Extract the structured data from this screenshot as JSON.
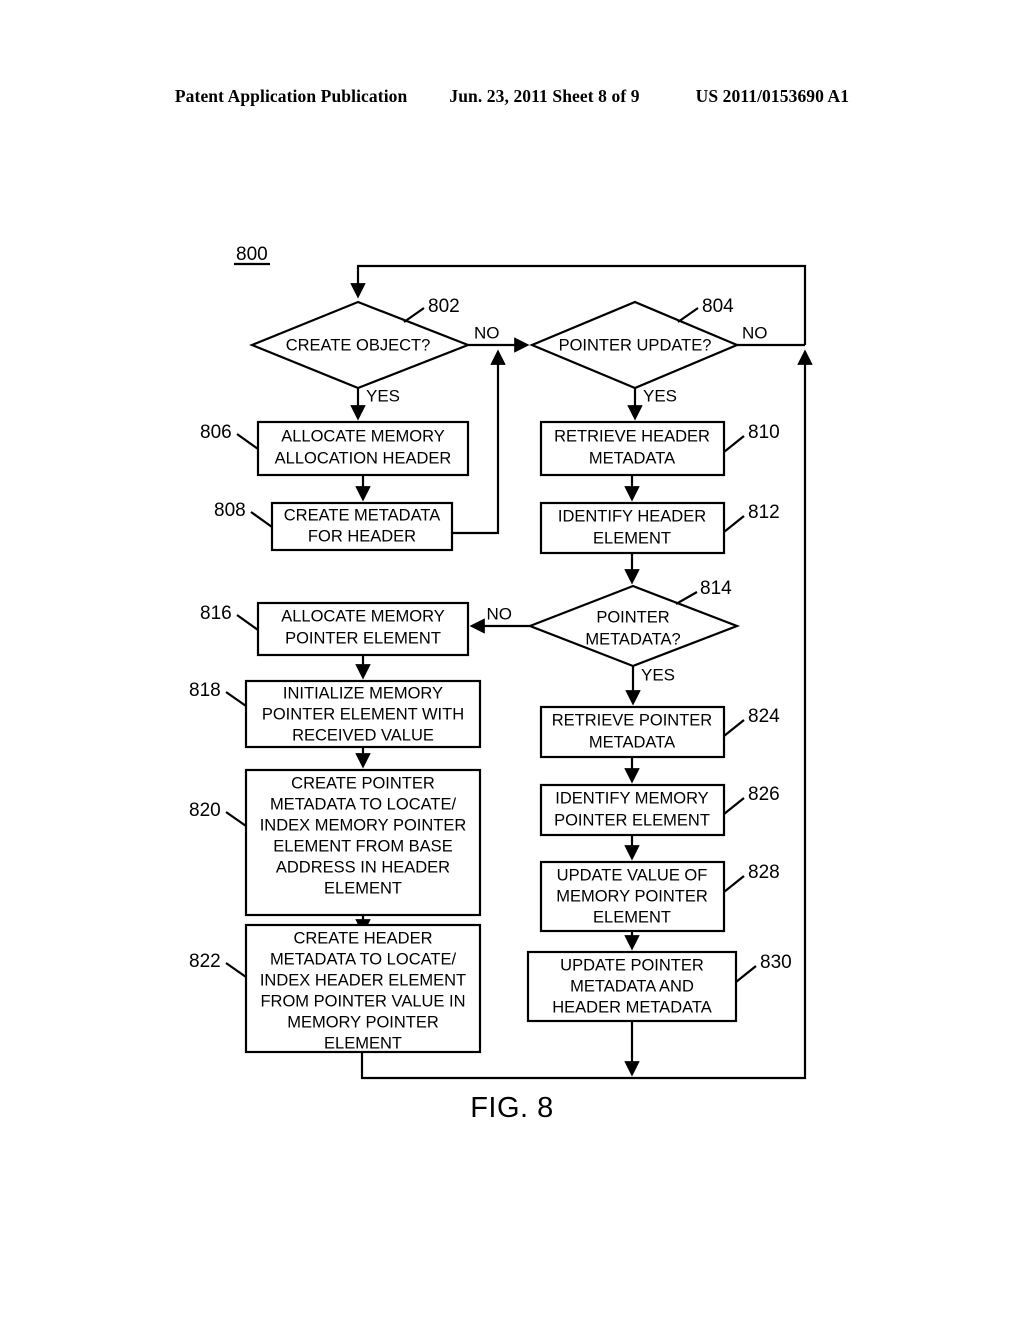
{
  "header": {
    "title": "Patent Application Publication",
    "date_sheet": "Jun. 23, 2011  Sheet 8 of 9",
    "publication_number": "US 2011/0153690 A1"
  },
  "figure": {
    "caption": "FIG. 8",
    "diagram_number": "800"
  },
  "chart_data": {
    "type": "diagram",
    "title": "FIG. 8",
    "diagram_number": "800",
    "nodes": [
      {
        "id": "802",
        "ref": "802",
        "shape": "diamond",
        "text": "CREATE OBJECT?",
        "lines": [
          "CREATE OBJECT?"
        ]
      },
      {
        "id": "804",
        "ref": "804",
        "shape": "diamond",
        "text": "POINTER UPDATE?",
        "lines": [
          "POINTER UPDATE?"
        ]
      },
      {
        "id": "806",
        "ref": "806",
        "shape": "process",
        "text": "ALLOCATE MEMORY ALLOCATION HEADER",
        "lines": [
          "ALLOCATE MEMORY",
          "ALLOCATION HEADER"
        ]
      },
      {
        "id": "808",
        "ref": "808",
        "shape": "process",
        "text": "CREATE METADATA FOR HEADER",
        "lines": [
          "CREATE METADATA",
          "FOR HEADER"
        ]
      },
      {
        "id": "810",
        "ref": "810",
        "shape": "process",
        "text": "RETRIEVE HEADER METADATA",
        "lines": [
          "RETRIEVE HEADER",
          "METADATA"
        ]
      },
      {
        "id": "812",
        "ref": "812",
        "shape": "process",
        "text": "IDENTIFY HEADER ELEMENT",
        "lines": [
          "IDENTIFY HEADER",
          "ELEMENT"
        ]
      },
      {
        "id": "814",
        "ref": "814",
        "shape": "diamond",
        "text": "POINTER METADATA?",
        "lines": [
          "POINTER",
          "METADATA?"
        ]
      },
      {
        "id": "816",
        "ref": "816",
        "shape": "process",
        "text": "ALLOCATE MEMORY POINTER ELEMENT",
        "lines": [
          "ALLOCATE MEMORY",
          "POINTER ELEMENT"
        ]
      },
      {
        "id": "818",
        "ref": "818",
        "shape": "process",
        "text": "INITIALIZE MEMORY POINTER ELEMENT WITH RECEIVED VALUE",
        "lines": [
          "INITIALIZE MEMORY",
          "POINTER ELEMENT WITH",
          "RECEIVED VALUE"
        ]
      },
      {
        "id": "820",
        "ref": "820",
        "shape": "process",
        "text": "CREATE POINTER METADATA TO LOCATE/INDEX MEMORY POINTER ELEMENT FROM BASE ADDRESS IN HEADER ELEMENT",
        "lines": [
          "CREATE POINTER",
          "METADATA TO LOCATE/",
          "INDEX MEMORY POINTER",
          "ELEMENT FROM BASE",
          "ADDRESS IN HEADER",
          "ELEMENT"
        ]
      },
      {
        "id": "822",
        "ref": "822",
        "shape": "process",
        "text": "CREATE HEADER METADATA TO LOCATE/INDEX HEADER ELEMENT FROM POINTER VALUE IN MEMORY POINTER ELEMENT",
        "lines": [
          "CREATE HEADER",
          "METADATA TO LOCATE/",
          "INDEX HEADER ELEMENT",
          "FROM POINTER VALUE IN",
          "MEMORY POINTER",
          "ELEMENT"
        ]
      },
      {
        "id": "824",
        "ref": "824",
        "shape": "process",
        "text": "RETRIEVE POINTER METADATA",
        "lines": [
          "RETRIEVE POINTER",
          "METADATA"
        ]
      },
      {
        "id": "826",
        "ref": "826",
        "shape": "process",
        "text": "IDENTIFY MEMORY POINTER ELEMENT",
        "lines": [
          "IDENTIFY MEMORY",
          "POINTER ELEMENT"
        ]
      },
      {
        "id": "828",
        "ref": "828",
        "shape": "process",
        "text": "UPDATE VALUE OF MEMORY POINTER ELEMENT",
        "lines": [
          "UPDATE VALUE OF",
          "MEMORY POINTER",
          "ELEMENT"
        ]
      },
      {
        "id": "830",
        "ref": "830",
        "shape": "process",
        "text": "UPDATE POINTER METADATA AND HEADER METADATA",
        "lines": [
          "UPDATE POINTER",
          "METADATA AND",
          "HEADER METADATA"
        ]
      }
    ],
    "edges": [
      {
        "from": "802",
        "to": "806",
        "label": "YES"
      },
      {
        "from": "802",
        "to": "804",
        "label": "NO"
      },
      {
        "from": "806",
        "to": "808",
        "label": ""
      },
      {
        "from": "808",
        "to": "804",
        "label": ""
      },
      {
        "from": "804",
        "to": "810",
        "label": "YES"
      },
      {
        "from": "804",
        "to": "802",
        "label": "NO"
      },
      {
        "from": "810",
        "to": "812",
        "label": ""
      },
      {
        "from": "812",
        "to": "814",
        "label": ""
      },
      {
        "from": "814",
        "to": "816",
        "label": "NO"
      },
      {
        "from": "814",
        "to": "824",
        "label": "YES"
      },
      {
        "from": "816",
        "to": "818",
        "label": ""
      },
      {
        "from": "818",
        "to": "820",
        "label": ""
      },
      {
        "from": "820",
        "to": "822",
        "label": ""
      },
      {
        "from": "822",
        "to": "802",
        "label": ""
      },
      {
        "from": "824",
        "to": "826",
        "label": ""
      },
      {
        "from": "826",
        "to": "828",
        "label": ""
      },
      {
        "from": "828",
        "to": "830",
        "label": ""
      },
      {
        "from": "830",
        "to": "802",
        "label": ""
      }
    ],
    "branch_labels": {
      "d802_no": "NO",
      "d802_yes": "YES",
      "d804_no": "NO",
      "d804_yes": "YES",
      "d814_no": "NO",
      "d814_yes": "YES"
    }
  }
}
